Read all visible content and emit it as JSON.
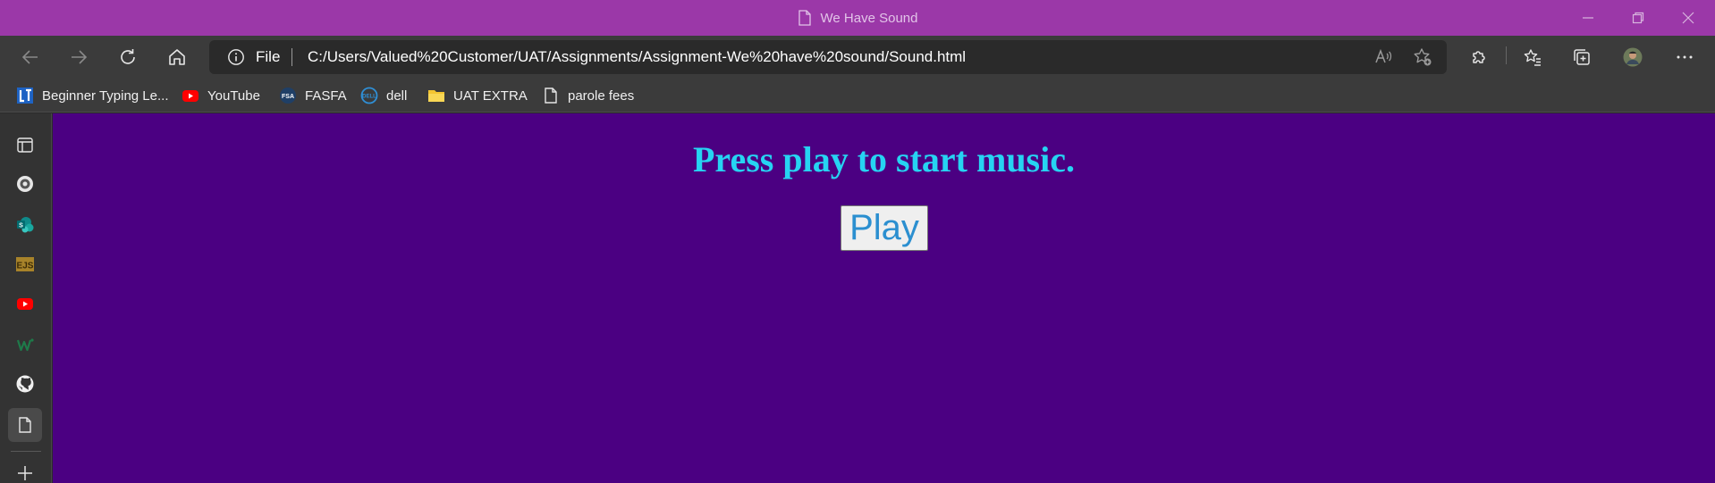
{
  "window": {
    "title": "We Have Sound",
    "controls": [
      "minimize-icon",
      "restore-icon",
      "close-icon"
    ]
  },
  "toolbar": {
    "buttons": [
      "back-arrow-icon",
      "forward-arrow-icon",
      "refresh-icon",
      "home-icon"
    ],
    "address": {
      "scheme_label": "File",
      "url": "C:/Users/Valued%20Customer/UAT/Assignments/Assignment-We%20have%20sound/Sound.html"
    },
    "right_icons": [
      "read-aloud-icon",
      "add-favorite-icon",
      "extensions-icon",
      "favorites-icon",
      "collections-icon",
      "profile-avatar",
      "more-options-icon"
    ]
  },
  "favorites": [
    {
      "label": "Beginner Typing Le...",
      "icon": "typing-site-icon"
    },
    {
      "label": "YouTube",
      "icon": "youtube-icon"
    },
    {
      "label": "FASFA",
      "icon": "fsa-icon"
    },
    {
      "label": "dell",
      "icon": "dell-icon"
    },
    {
      "label": "UAT EXTRA",
      "icon": "folder-icon"
    },
    {
      "label": "parole fees",
      "icon": "page-icon"
    }
  ],
  "sidebar": {
    "items": [
      "tab-actions-icon",
      "chat-icon",
      "sharepoint-icon",
      "ejs-icon",
      "youtube-icon",
      "w-site-icon",
      "github-icon",
      "current-page-icon",
      "add-icon"
    ]
  },
  "page": {
    "heading": "Press play to start music.",
    "play_label": "Play",
    "background": "#4b0082",
    "heading_color": "#26d4f2"
  }
}
